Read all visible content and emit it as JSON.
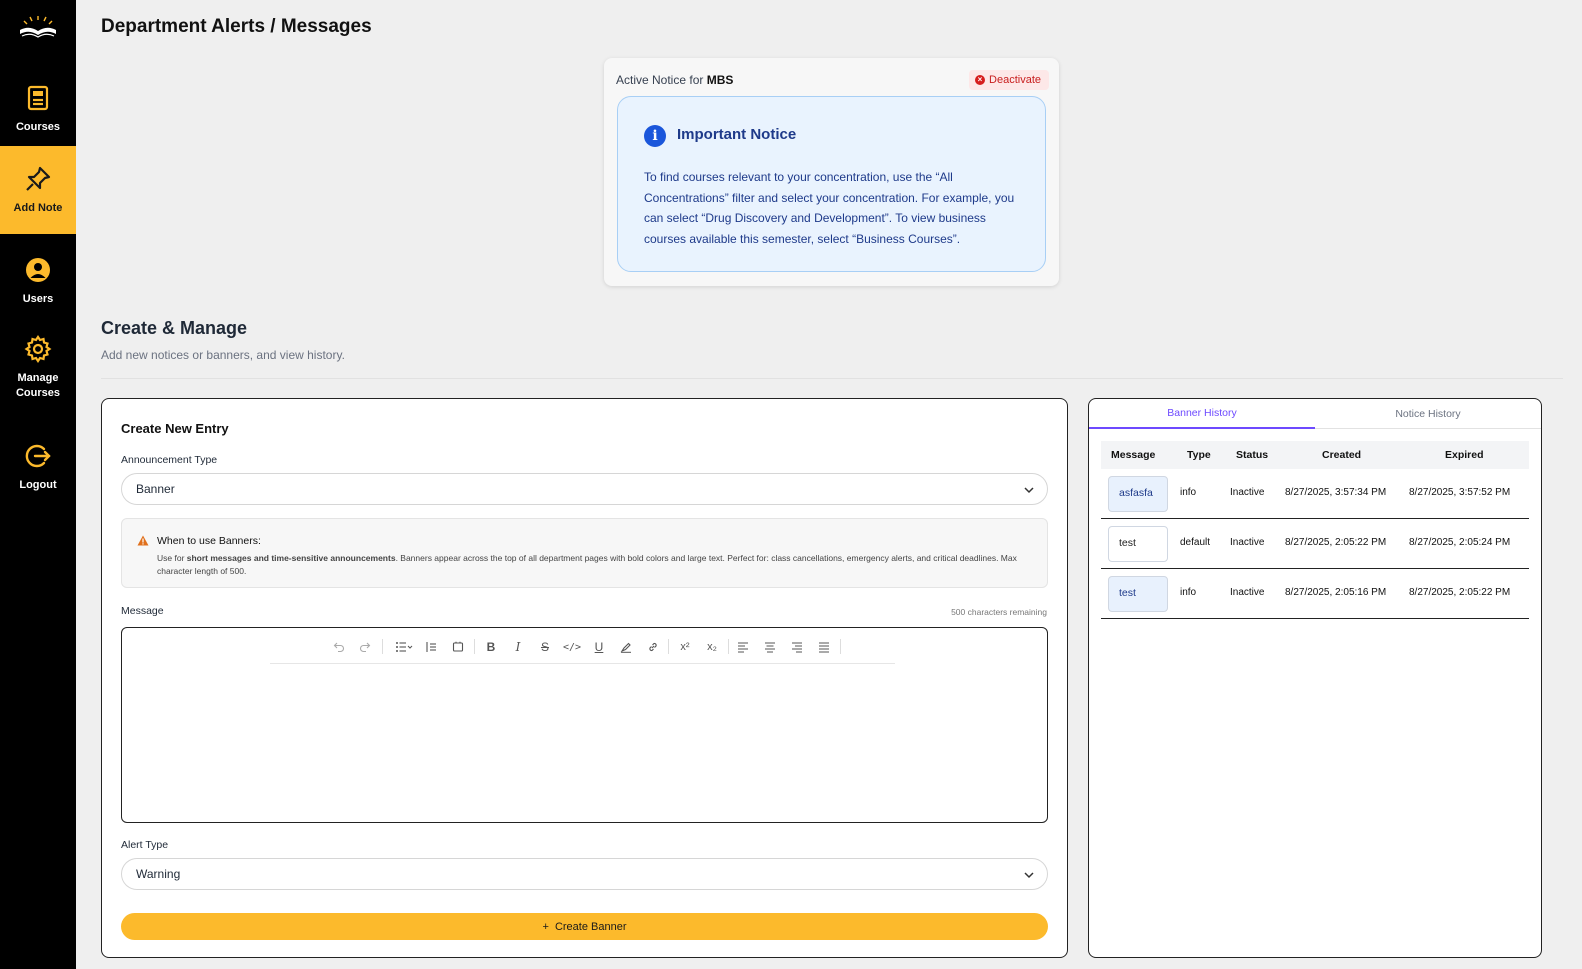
{
  "sidebar": {
    "items": [
      {
        "label": "Courses",
        "icon": "courses-icon",
        "active": false
      },
      {
        "label": "Add Note",
        "icon": "pin-icon",
        "active": true
      },
      {
        "label": "Users",
        "icon": "user-icon",
        "active": false
      },
      {
        "label": "Manage\nCourses",
        "icon": "gear-icon",
        "active": false
      },
      {
        "label": "Logout",
        "icon": "logout-icon",
        "active": false
      }
    ],
    "accent": "#fcba2c"
  },
  "page": {
    "title": "Department Alerts / Messages"
  },
  "active_notice": {
    "prefix": "Active Notice for ",
    "department": "MBS",
    "deactivate_label": "Deactivate",
    "title": "Important Notice",
    "body": "To find courses relevant to your concentration, use the “All Concentrations” filter and select your concentration. For example, you can select “Drug Discovery and Development”. To view business courses available this semester, select “Business Courses”."
  },
  "section": {
    "title": "Create & Manage",
    "subtitle": "Add new notices or banners, and view history."
  },
  "create_form": {
    "title": "Create New Entry",
    "announcement_type_label": "Announcement Type",
    "announcement_type_value": "Banner",
    "hint_title": "When to use Banners:",
    "hint_prefix": "Use for ",
    "hint_bold": "short messages and time-sensitive announcements",
    "hint_rest": ". Banners appear across the top of all department pages with bold colors and large text. Perfect for: class cancellations, emergency alerts, and critical deadlines. Max character length of 500.",
    "message_label": "Message",
    "chars_remaining": "500 characters remaining",
    "alert_type_label": "Alert Type",
    "alert_type_value": "Warning",
    "submit_label": "Create Banner",
    "submit_icon": "+"
  },
  "history": {
    "tabs": [
      {
        "label": "Banner History",
        "active": true
      },
      {
        "label": "Notice History",
        "active": false
      }
    ],
    "columns": [
      "Message",
      "Type",
      "Status",
      "Created",
      "Expired"
    ],
    "rows": [
      {
        "message": "asfasfa",
        "type": "info",
        "status": "Inactive",
        "created": "8/27/2025, 3:57:34 PM",
        "expired": "8/27/2025, 3:57:52 PM"
      },
      {
        "message": "test",
        "type": "default",
        "status": "Inactive",
        "created": "8/27/2025, 2:05:22 PM",
        "expired": "8/27/2025, 2:05:24 PM"
      },
      {
        "message": "test",
        "type": "info",
        "status": "Inactive",
        "created": "8/27/2025, 2:05:16 PM",
        "expired": "8/27/2025, 2:05:22 PM"
      }
    ]
  }
}
